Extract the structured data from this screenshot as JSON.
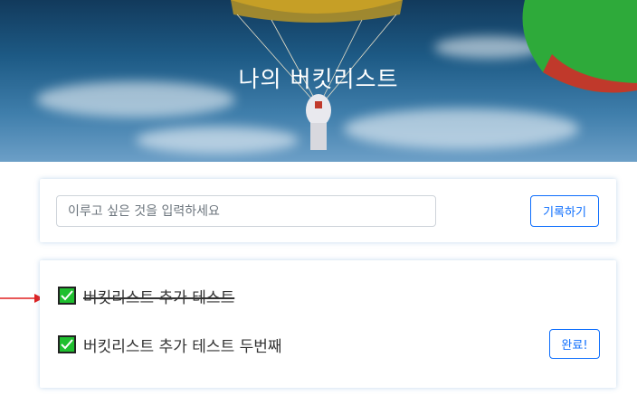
{
  "header": {
    "title": "나의 버킷리스트"
  },
  "input_form": {
    "placeholder": "이루고 싶은 것을 입력하세요",
    "value": "",
    "submit_label": "기록하기"
  },
  "bucket_list": {
    "items": [
      {
        "label": "버킷리스트 추가 테스트",
        "completed": true
      },
      {
        "label": "버킷리스트 추가 테스트 두번째",
        "completed": false,
        "action_label": "완료!"
      }
    ]
  },
  "colors": {
    "accent": "#0d6efd",
    "check_green": "#1fbf2f",
    "annotation_arrow": "#e02020"
  }
}
